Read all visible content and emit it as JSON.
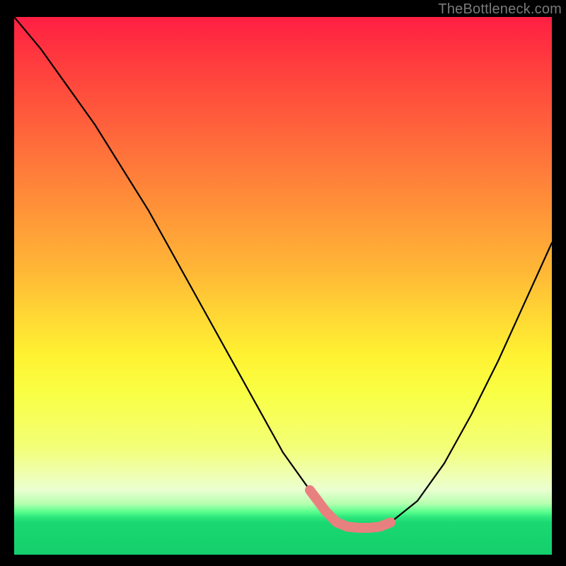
{
  "watermark": "TheBottleneck.com",
  "chart_data": {
    "type": "line",
    "title": "",
    "xlabel": "",
    "ylabel": "",
    "xlim": [
      0,
      100
    ],
    "ylim": [
      0,
      100
    ],
    "series": [
      {
        "name": "curve",
        "x": [
          0,
          5,
          10,
          15,
          20,
          25,
          30,
          35,
          40,
          45,
          50,
          55,
          58,
          60,
          62,
          64,
          66,
          68,
          70,
          75,
          80,
          85,
          90,
          95,
          100
        ],
        "values": [
          100,
          94,
          87,
          80,
          72,
          64,
          55,
          46,
          37,
          28,
          19,
          12,
          8,
          6,
          5.2,
          5.0,
          5.0,
          5.2,
          6,
          10,
          17,
          26,
          36,
          47,
          58
        ]
      }
    ],
    "highlight": {
      "name": "valley-highlight",
      "color": "#e98080",
      "x": [
        55,
        58,
        60,
        62,
        64,
        66,
        68,
        70
      ],
      "values": [
        12,
        8,
        6,
        5.2,
        5.0,
        5.0,
        5.2,
        6
      ]
    }
  }
}
